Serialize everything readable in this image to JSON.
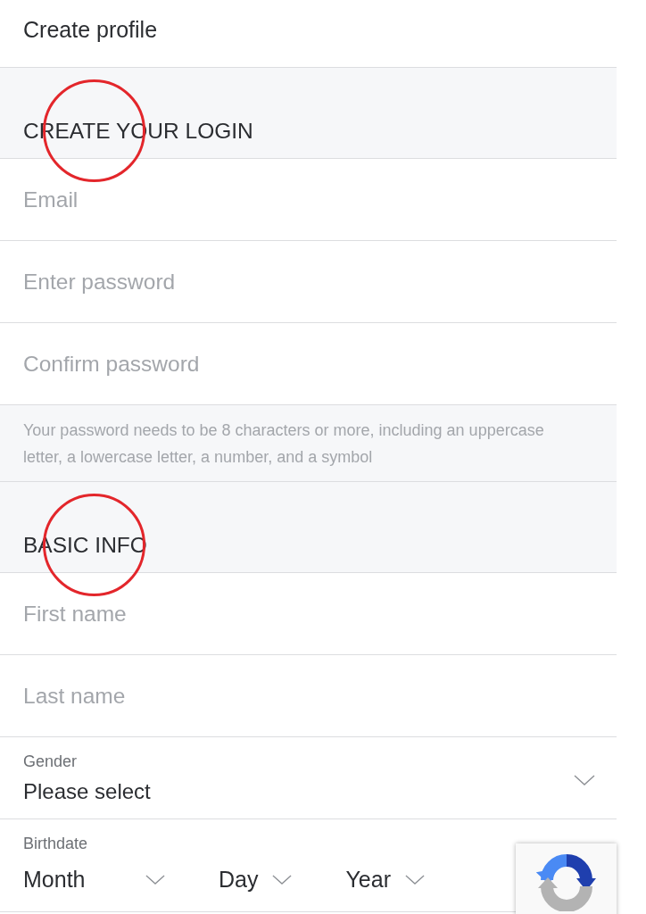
{
  "header": {
    "title": "Create profile"
  },
  "sections": [
    {
      "heading": "CREATE YOUR LOGIN",
      "highlighted": true,
      "fields": [
        {
          "kind": "email",
          "placeholder": "Email"
        },
        {
          "kind": "password",
          "placeholder": "Enter password"
        },
        {
          "kind": "password",
          "placeholder": "Confirm password"
        },
        {
          "kind": "note",
          "text": "Your password needs to be 8 characters or more, including an uppercase letter, a lowercase letter, a number, and a symbol"
        }
      ]
    },
    {
      "heading": "BASIC INFO",
      "highlighted": true,
      "fields": [
        {
          "kind": "text",
          "placeholder": "First name"
        },
        {
          "kind": "text",
          "placeholder": "Last name"
        },
        {
          "kind": "select",
          "label": "Gender",
          "value": "Please select"
        },
        {
          "kind": "date",
          "label": "Birthdate",
          "parts": [
            {
              "value": "Month"
            },
            {
              "value": "Day"
            },
            {
              "value": "Year"
            }
          ]
        }
      ]
    }
  ]
}
